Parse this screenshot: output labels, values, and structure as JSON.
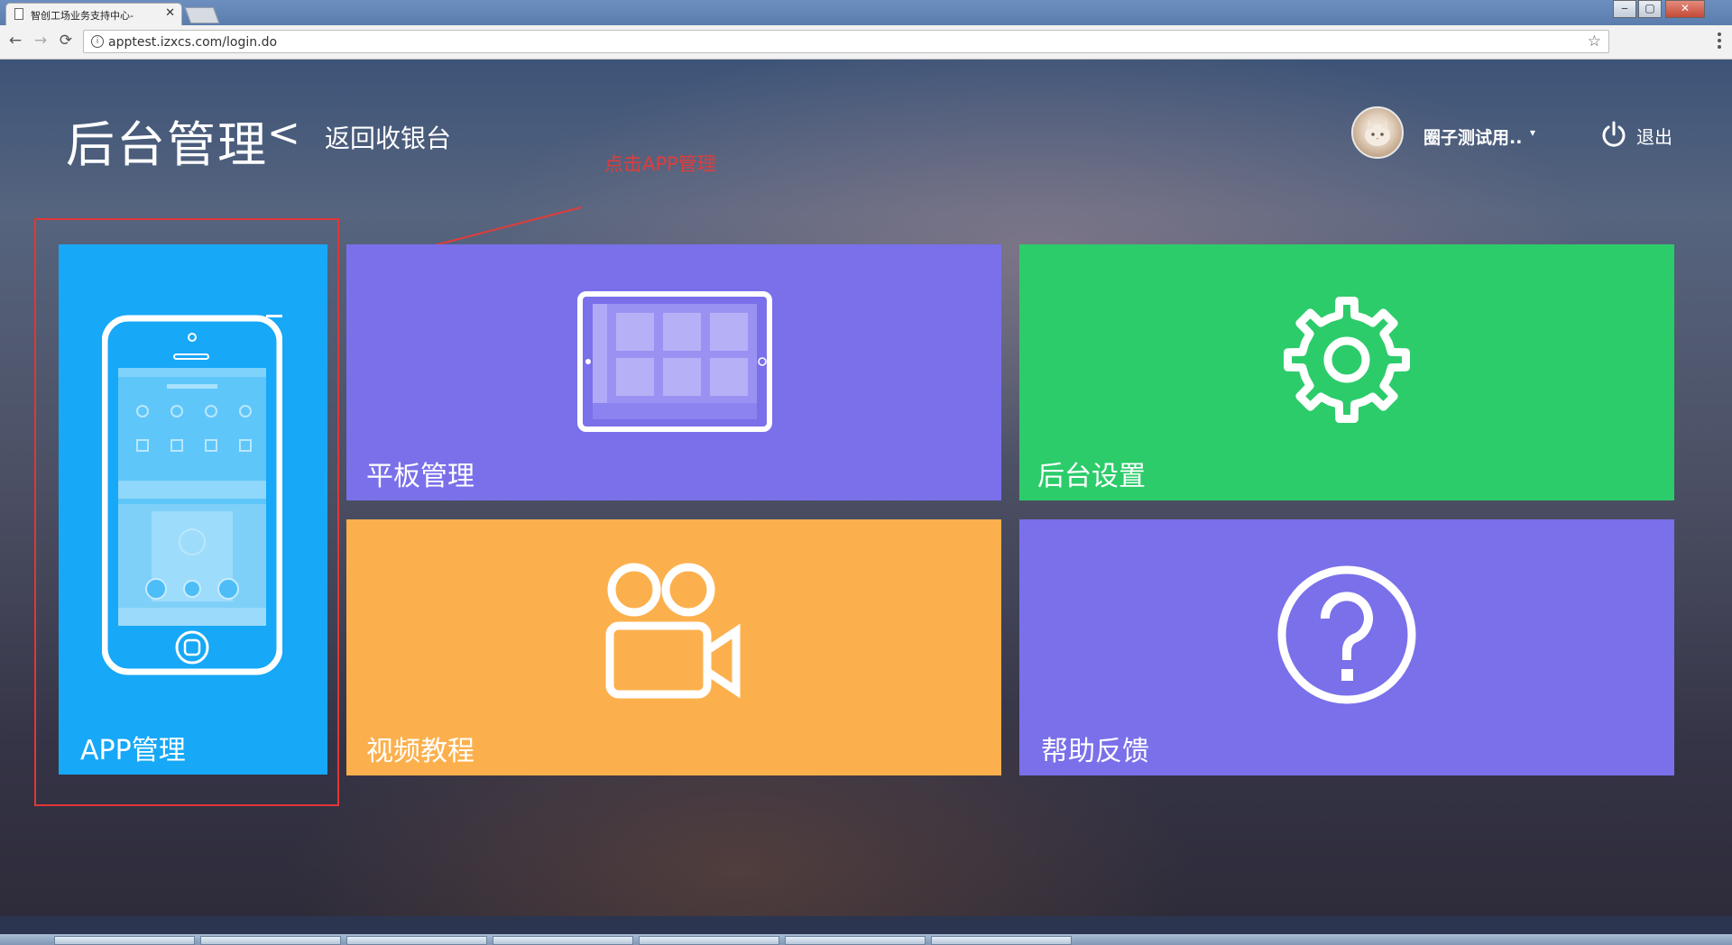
{
  "browser": {
    "tab_title": "智创工场业务支持中心-",
    "tab_close": "✕",
    "url": "apptest.izxcs.com/login.do",
    "back": "←",
    "forward": "→",
    "reload": "⟳",
    "info": "i",
    "star": "☆",
    "window_min": "‒",
    "window_max": "▢",
    "window_close": "✕"
  },
  "header": {
    "title": "后台管理",
    "back_chevron": "<",
    "back_link": "返回收银台",
    "username": "圈子测试用..",
    "caret": "▾",
    "logout": "退出"
  },
  "annotation": {
    "text": "点击APP管理",
    "color": "#e03c3c"
  },
  "tiles": {
    "app": {
      "label": "APP管理",
      "color": "#17a8f7"
    },
    "tablet": {
      "label": "平板管理",
      "color": "#7a70ea"
    },
    "settings": {
      "label": "后台设置",
      "color": "#2ccc6a"
    },
    "video": {
      "label": "视频教程",
      "color": "#fcb04d"
    },
    "help": {
      "label": "帮助反馈",
      "color": "#7a70ea"
    }
  },
  "icons": {
    "app": "phone-icon",
    "tablet": "tablet-icon",
    "settings": "gear-icon",
    "video": "video-camera-icon",
    "help": "question-circle-icon",
    "logout": "power-icon"
  }
}
